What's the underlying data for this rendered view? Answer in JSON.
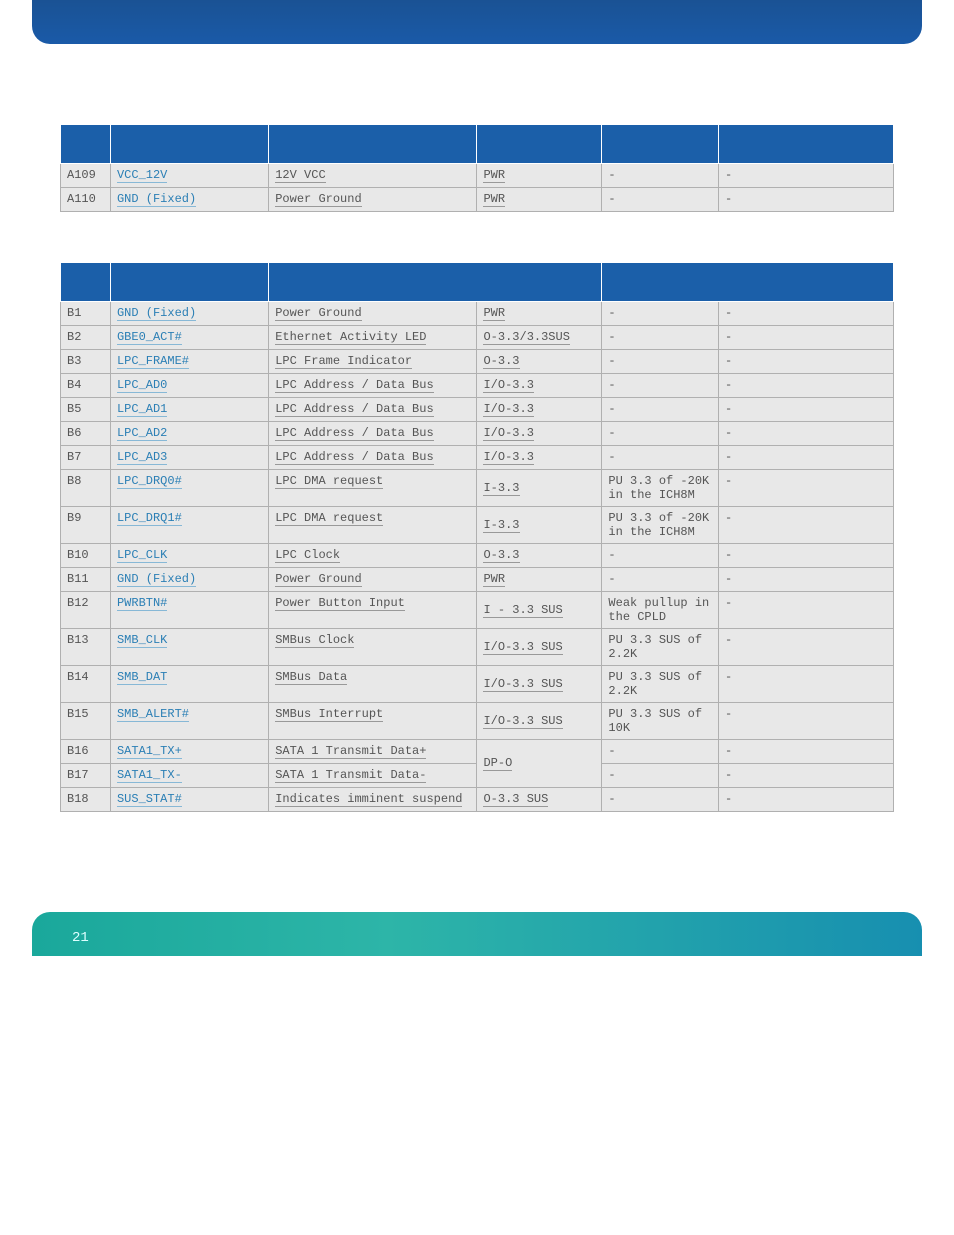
{
  "table1_rows": [
    {
      "pin": "A109",
      "signal": "VCC_12V",
      "desc": "12V VCC",
      "type": "PWR",
      "pu": "-",
      "note": "-"
    },
    {
      "pin": "A110",
      "signal": "GND (Fixed)",
      "desc": "Power Ground",
      "type": "PWR",
      "pu": "-",
      "note": "-"
    }
  ],
  "table2_rows": [
    {
      "pin": "B1",
      "signal": "GND (Fixed)",
      "desc": "Power Ground",
      "type": "PWR",
      "pu": "-",
      "note": "-"
    },
    {
      "pin": "B2",
      "signal": "GBE0_ACT#",
      "desc": "Ethernet Activity LED",
      "type": "O-3.3/3.3SUS",
      "pu": "-",
      "note": "-"
    },
    {
      "pin": "B3",
      "signal": "LPC_FRAME#",
      "desc": "LPC Frame Indicator",
      "type": "O-3.3",
      "pu": "-",
      "note": "-"
    },
    {
      "pin": "B4",
      "signal": "LPC_AD0",
      "desc": "LPC Address / Data Bus",
      "type": "I/O-3.3",
      "pu": "-",
      "note": "-"
    },
    {
      "pin": "B5",
      "signal": "LPC_AD1",
      "desc": "LPC Address / Data Bus",
      "type": "I/O-3.3",
      "pu": "-",
      "note": "-"
    },
    {
      "pin": "B6",
      "signal": "LPC_AD2",
      "desc": "LPC Address / Data Bus",
      "type": "I/O-3.3",
      "pu": "-",
      "note": "-"
    },
    {
      "pin": "B7",
      "signal": "LPC_AD3",
      "desc": "LPC Address / Data Bus",
      "type": "I/O-3.3",
      "pu": "-",
      "note": "-"
    },
    {
      "pin": "B8",
      "signal": "LPC_DRQ0#",
      "desc": "LPC DMA request",
      "type": "I-3.3",
      "pu": "PU 3.3 of -20K in the ICH8M",
      "note": "-"
    },
    {
      "pin": "B9",
      "signal": "LPC_DRQ1#",
      "desc": "LPC DMA request",
      "type": "I-3.3",
      "pu": "PU 3.3 of -20K in the ICH8M",
      "note": "-"
    },
    {
      "pin": "B10",
      "signal": "LPC_CLK",
      "desc": "LPC Clock",
      "type": "O-3.3",
      "pu": "-",
      "note": "-"
    },
    {
      "pin": "B11",
      "signal": "GND (Fixed)",
      "desc": "Power Ground",
      "type": "PWR",
      "pu": "-",
      "note": "-"
    },
    {
      "pin": "B12",
      "signal": "PWRBTN#",
      "desc": "Power Button Input",
      "type": "I - 3.3 SUS",
      "pu": "Weak pullup in the CPLD",
      "note": "-"
    },
    {
      "pin": "B13",
      "signal": "SMB_CLK",
      "desc": "SMBus Clock",
      "type": "I/O-3.3 SUS",
      "pu": "PU 3.3 SUS of 2.2K",
      "note": "-"
    },
    {
      "pin": "B14",
      "signal": "SMB_DAT",
      "desc": "SMBus Data",
      "type": "I/O-3.3 SUS",
      "pu": "PU 3.3 SUS of 2.2K",
      "note": "-"
    },
    {
      "pin": "B15",
      "signal": "SMB_ALERT#",
      "desc": "SMBus Interrupt",
      "type": "I/O-3.3 SUS",
      "pu": "PU 3.3 SUS of 10K",
      "note": "-"
    },
    {
      "pin": "B16",
      "signal": "SATA1_TX+",
      "desc": "SATA 1  Transmit Data+",
      "type": "DP-O",
      "pu": "-",
      "note": "-",
      "rowspan_type": 2
    },
    {
      "pin": "B17",
      "signal": "SATA1_TX-",
      "desc": "SATA 1 Transmit Data-",
      "type": "",
      "pu": "-",
      "note": "-",
      "skip_type": true
    },
    {
      "pin": "B18",
      "signal": "SUS_STAT#",
      "desc": "Indicates imminent suspend",
      "type": "O-3.3 SUS",
      "pu": "-",
      "note": "-"
    }
  ],
  "page_number": "21"
}
